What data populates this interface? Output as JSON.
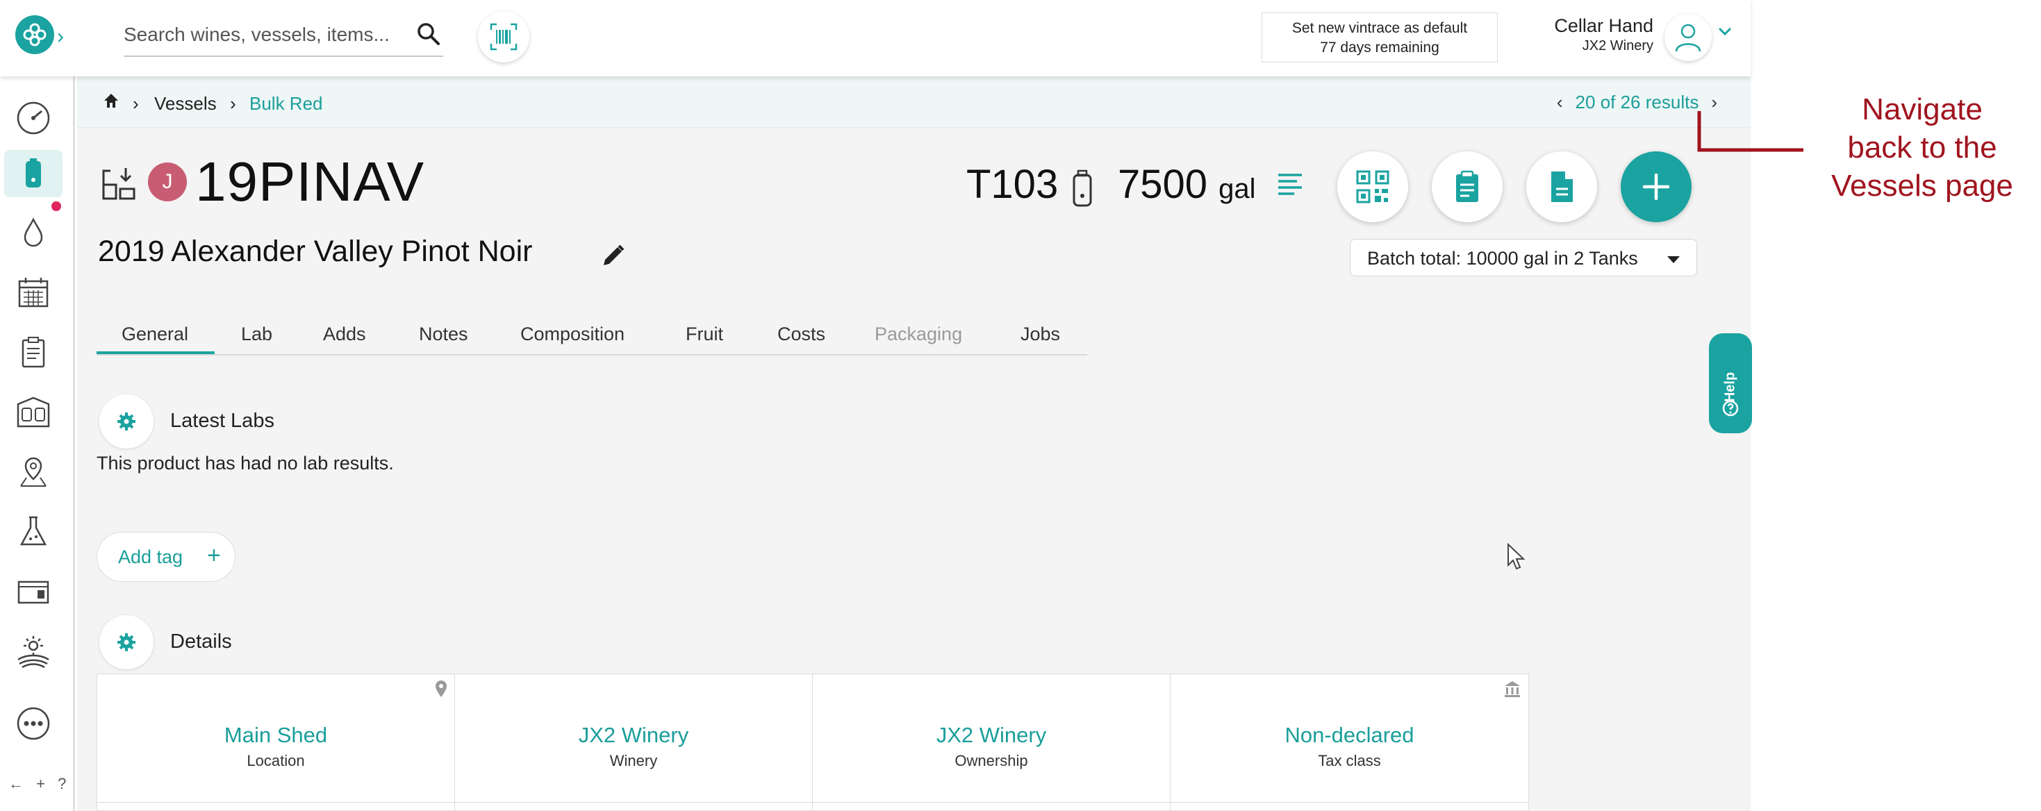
{
  "search": {
    "placeholder": "Search wines, vessels, items..."
  },
  "license": {
    "line1": "Set new vintrace as default",
    "line2": "77 days remaining"
  },
  "user": {
    "name": "Cellar Hand",
    "org": "JX2 Winery"
  },
  "sidebar": {
    "items": [
      {
        "name": "dashboard-icon"
      },
      {
        "name": "vessel-icon",
        "active": true
      },
      {
        "name": "drop-icon",
        "notification": true
      },
      {
        "name": "calendar-icon"
      },
      {
        "name": "clipboard-icon"
      },
      {
        "name": "tanks-icon"
      },
      {
        "name": "location-icon"
      },
      {
        "name": "flask-icon"
      },
      {
        "name": "barrel-icon"
      },
      {
        "name": "vineyard-icon"
      },
      {
        "name": "more-icon"
      }
    ],
    "footer": "← + ?"
  },
  "breadcrumb": {
    "vessels": "Vessels",
    "current": "Bulk Red"
  },
  "pagination": {
    "label": "20 of 26 results",
    "prev": "‹",
    "next": "›"
  },
  "product": {
    "badge": "J",
    "code": "19PINAV",
    "name": "2019 Alexander Valley Pinot Noir",
    "vessel": "T103",
    "volume": "7500",
    "volume_unit": "gal"
  },
  "batch": {
    "label": "Batch total: 10000 gal in 2 Tanks"
  },
  "tabs": [
    {
      "label": "General",
      "active": true
    },
    {
      "label": "Lab"
    },
    {
      "label": "Adds"
    },
    {
      "label": "Notes"
    },
    {
      "label": "Composition"
    },
    {
      "label": "Fruit"
    },
    {
      "label": "Costs"
    },
    {
      "label": "Packaging",
      "disabled": true
    },
    {
      "label": "Jobs"
    }
  ],
  "labs": {
    "title": "Latest Labs",
    "empty": "This product has had no lab results."
  },
  "tags": {
    "add_label": "Add tag",
    "add_icon": "+"
  },
  "details": {
    "title": "Details",
    "cells": [
      {
        "value": "Main Shed",
        "label": "Location"
      },
      {
        "value": "JX2 Winery",
        "label": "Winery"
      },
      {
        "value": "JX2 Winery",
        "label": "Ownership"
      },
      {
        "value": "Non-declared",
        "label": "Tax class"
      }
    ]
  },
  "help": {
    "label": "Help"
  },
  "annotation": {
    "text_line1": "Navigate",
    "text_line2": "back to the",
    "text_line3": "Vessels page"
  },
  "colors": {
    "accent": "#1aa3a0",
    "badge": "#c85c72",
    "annotation": "#a0141e",
    "notification": "#e0245e"
  }
}
